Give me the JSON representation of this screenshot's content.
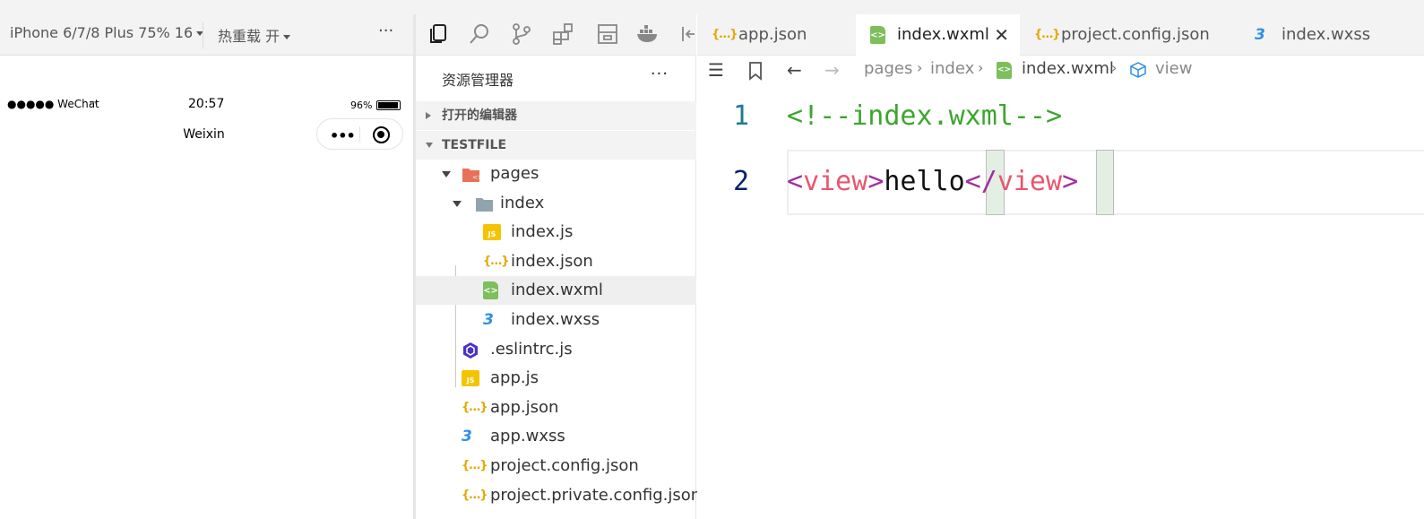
{
  "simulator": {
    "device_select": "iPhone 6/7/8 Plus 75% 16",
    "hot_reload": "热重载 开",
    "more": "···",
    "status": {
      "carrier": "●●●●● WeChat",
      "time": "20:57",
      "battery": "96%"
    },
    "nav_title": "Weixin",
    "capsule_dots": "•••"
  },
  "activity_bar": {
    "icons": [
      "files-icon",
      "search-icon",
      "source-control-icon",
      "extensions-icon",
      "layout-icon",
      "docker-icon",
      "panel-toggle-icon"
    ]
  },
  "explorer": {
    "title": "资源管理器",
    "more": "···",
    "open_editors_label": "打开的编辑器",
    "project_label": "TESTFILE",
    "tree": [
      {
        "label": "pages",
        "type": "folder-open",
        "depth": 1
      },
      {
        "label": "index",
        "type": "folder-open",
        "depth": 2
      },
      {
        "label": "index.js",
        "type": "js",
        "depth": 3
      },
      {
        "label": "index.json",
        "type": "json",
        "depth": 3
      },
      {
        "label": "index.wxml",
        "type": "wxml",
        "depth": 3,
        "selected": true
      },
      {
        "label": "index.wxss",
        "type": "wxss",
        "depth": 3
      },
      {
        "label": ".eslintrc.js",
        "type": "eslint",
        "depth": 1
      },
      {
        "label": "app.js",
        "type": "js",
        "depth": 1
      },
      {
        "label": "app.json",
        "type": "json",
        "depth": 1
      },
      {
        "label": "app.wxss",
        "type": "wxss",
        "depth": 1
      },
      {
        "label": "project.config.json",
        "type": "json",
        "depth": 1
      },
      {
        "label": "project.private.config.json",
        "type": "json",
        "depth": 1
      }
    ]
  },
  "editor": {
    "tabs": [
      {
        "label": "app.json",
        "type": "json",
        "active": false
      },
      {
        "label": "index.wxml",
        "type": "wxml",
        "active": true
      },
      {
        "label": "project.config.json",
        "type": "json",
        "active": false
      },
      {
        "label": "index.wxss",
        "type": "wxss",
        "active": false
      }
    ],
    "close_glyph": "✕",
    "breadcrumb": [
      "pages",
      "index",
      "index.wxml",
      "view"
    ],
    "line_numbers": [
      "1",
      "2"
    ],
    "line1_comment": "<!--index.wxml-->",
    "line2": {
      "open_lt": "<",
      "open_tag": "view",
      "open_gt": ">",
      "text": "hello",
      "close_lt": "</",
      "close_tag": "view",
      "close_gt": ">"
    }
  },
  "colors": {
    "comment": "#3da52e",
    "tag": "#e8566f",
    "bracket": "#a22ea0",
    "line_number": "#237893"
  }
}
